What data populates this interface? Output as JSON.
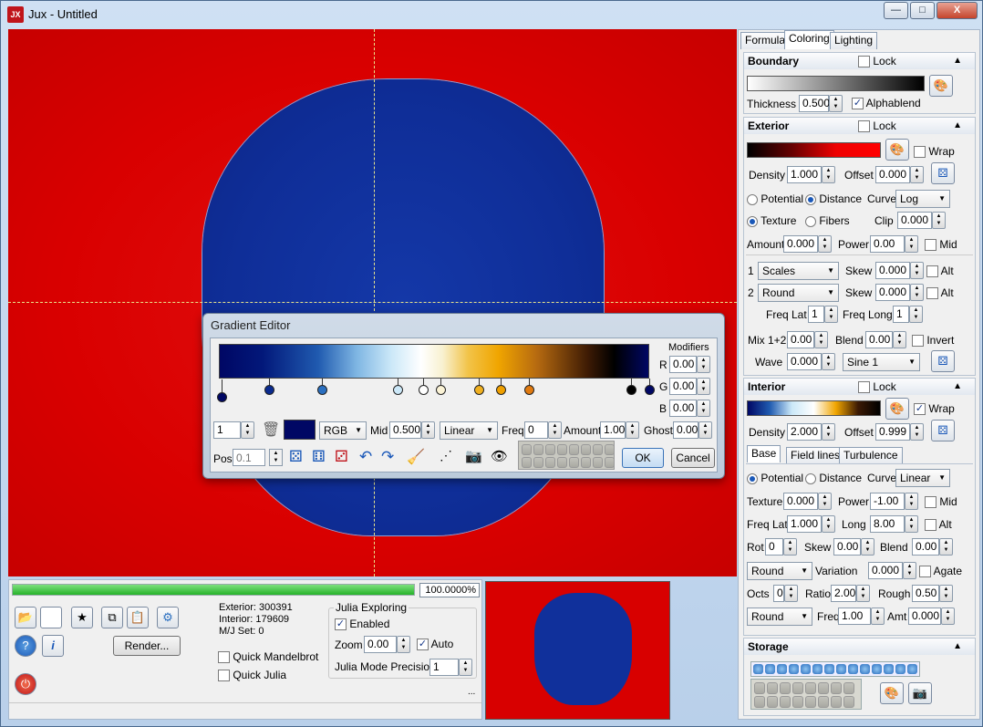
{
  "window": {
    "app_icon": "JX",
    "title": "Jux - Untitled",
    "minimize": "—",
    "maximize": "□",
    "close": "X"
  },
  "bottom": {
    "progress_fraction": 1.0,
    "progress_text": "100.0000%",
    "stats": {
      "exterior": "Exterior: 300391",
      "interior": "Interior: 179609",
      "mjset": "M/J Set: 0"
    },
    "render_button": "Render...",
    "quick_mandelbrot": "Quick Mandelbrot",
    "quick_julia": "Quick Julia",
    "julia_group": "Julia Exploring",
    "enabled": "Enabled",
    "zoom_label": "Zoom",
    "zoom_value": "0.00",
    "auto": "Auto",
    "julia_precision_label": "Julia Mode Precision",
    "julia_precision_value": "1",
    "ellipsis": "..."
  },
  "tabs": [
    "Formula",
    "Coloring",
    "Lighting"
  ],
  "boundary": {
    "title": "Boundary",
    "lock": "Lock",
    "thickness_label": "Thickness",
    "thickness": "0.500",
    "alphablend": "Alphablend"
  },
  "exterior": {
    "title": "Exterior",
    "lock": "Lock",
    "wrap": "Wrap",
    "density_label": "Density",
    "density": "1.000",
    "offset_label": "Offset",
    "offset": "0.000",
    "potential": "Potential",
    "distance": "Distance",
    "curve_label": "Curve",
    "curve": "Log",
    "texture": "Texture",
    "fibers": "Fibers",
    "clip_label": "Clip",
    "clip": "0.000",
    "amount_label": "Amount",
    "amount": "0.000",
    "power_label": "Power",
    "power": "0.00",
    "mid": "Mid",
    "layer1_num": "1",
    "layer1": "Scales",
    "skew1_label": "Skew",
    "skew1": "0.000",
    "alt1": "Alt",
    "layer2_num": "2",
    "layer2": "Round",
    "skew2_label": "Skew",
    "skew2": "0.000",
    "alt2": "Alt",
    "freq_lat_label": "Freq Lat",
    "freq_lat": "1",
    "freq_long_label": "Freq Long",
    "freq_long": "1",
    "mix_label": "Mix 1+2",
    "mix": "0.00",
    "blend_label": "Blend",
    "blend": "0.00",
    "invert": "Invert",
    "wave_label": "Wave",
    "wave": "0.000",
    "wave_type": "Sine 1"
  },
  "interior": {
    "title": "Interior",
    "lock": "Lock",
    "wrap": "Wrap",
    "density_label": "Density",
    "density": "2.000",
    "offset_label": "Offset",
    "offset": "0.999",
    "subtabs": [
      "Base",
      "Field lines",
      "Turbulence"
    ],
    "potential": "Potential",
    "distance": "Distance",
    "curve_label": "Curve",
    "curve": "Linear",
    "texture_label": "Texture",
    "texture": "0.000",
    "power_label": "Power",
    "power": "-1.00",
    "mid": "Mid",
    "freq_lat_label": "Freq Lat",
    "freq_lat": "1.000",
    "long_label": "Long",
    "long": "8.00",
    "alt": "Alt",
    "rot_label": "Rot",
    "rot": "0",
    "skew_label": "Skew",
    "skew": "0.00",
    "blend_label": "Blend",
    "blend": "0.00",
    "round1": "Round",
    "variation_label": "Variation",
    "variation": "0.000",
    "agate": "Agate",
    "octs_label": "Octs",
    "octs": "0",
    "ratio_label": "Ratio",
    "ratio": "2.00",
    "rough_label": "Rough",
    "rough": "0.50",
    "round2": "Round",
    "freq_label": "Freq",
    "freq": "1.00",
    "amt_label": "Amt",
    "amt": "0.000"
  },
  "storage": {
    "title": "Storage"
  },
  "gradient_editor": {
    "title": "Gradient Editor",
    "modifiers": "Modifiers",
    "r_label": "R",
    "r": "0.00",
    "g_label": "G",
    "g": "0.00",
    "b_label": "B",
    "b": "0.00",
    "index": "1",
    "colorspace": "RGB",
    "mid_label": "Mid",
    "mid": "0.500",
    "interp": "Linear",
    "freq_label": "Freq",
    "freq": "0",
    "amount_label": "Amount",
    "amount": "1.00",
    "ghost_label": "Ghost",
    "ghost": "0.00",
    "pos_label": "Pos",
    "pos_placeholder": "0.1",
    "ok": "OK",
    "cancel": "Cancel",
    "stop_colors": [
      "#000764",
      "#0a2a8e",
      "#2a6fc0",
      "#cce8f8",
      "#ffffff",
      "#fbf3d6",
      "#f0b020",
      "#f0a000",
      "#e07a10",
      "#000000",
      "#000764"
    ]
  },
  "colors": {
    "exterior_red": "#d90000",
    "interior_blue": "#0f2e98",
    "accent": "#1a58b8"
  }
}
